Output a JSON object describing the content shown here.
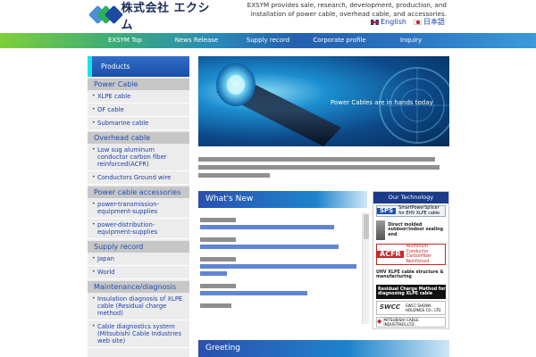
{
  "header": {
    "logo_text": "株式会社 エクシム",
    "tagline": "EXSYM provides sale, research, development, production, and installation of power cable, overhead cable, and accessories.",
    "lang_english": "English",
    "lang_japanese": "日本語"
  },
  "nav": [
    "EXSYM Top",
    "News Release",
    "Supply record",
    "Corporate profile",
    "Inquiry"
  ],
  "sidebar": {
    "title": "Products",
    "sections": [
      {
        "heading": "Power Cable",
        "items": [
          "XLPE cable",
          "OF cable",
          "Submarine cable"
        ]
      },
      {
        "heading": "Overhead cable",
        "items": [
          "Low sug aluminum conductor carbon fiber reinforced(ACFR)",
          "Conductors Ground wire"
        ]
      },
      {
        "heading": "Power cable accessories",
        "items": [
          "power-transmission-equipment-supplies",
          "power-distribution-equipment-supplies"
        ]
      },
      {
        "heading": "Supply record",
        "items": [
          "Japan",
          "World"
        ]
      },
      {
        "heading": "Maintenance/diagnosis",
        "items": [
          "Insulation diagnosis of XLPE cable (Residual charge method)",
          "Cable diagnostics system (Mitsubishi Cable Industries web site)"
        ]
      }
    ]
  },
  "hero": {
    "caption": "Power Cables are in hands today"
  },
  "whats_new": {
    "title": "What's New"
  },
  "tech": {
    "title": "Our Technology",
    "items": [
      {
        "badge": "SPS",
        "text": "SmartPowerSplicer for EHV XLPE cable",
        "color": "#1a4fa8"
      },
      {
        "badge": "",
        "text": "Direct molded outdoor/indoor sealing end",
        "color": "#333333"
      },
      {
        "badge": "ACFR",
        "text": "Aluminum Conductor Carbonfiber Reinforced",
        "color": "#c62828"
      },
      {
        "badge": "",
        "text": "UHV XLPE cable structure & manufacturing",
        "color": "#333333"
      },
      {
        "badge": "",
        "text": "Residual Charge Method for diagnosing XLPE cable",
        "color": "#1a3a8a"
      },
      {
        "badge": "SWCC",
        "text": "SWCC SHOWA HOLDINGS CO., LTD.",
        "color": "#555555"
      },
      {
        "badge": "",
        "text": "MITSUBISHI CABLE INDUSTRIES,LTD.",
        "color": "#c62828"
      }
    ]
  },
  "greeting": {
    "title": "Greeting"
  }
}
